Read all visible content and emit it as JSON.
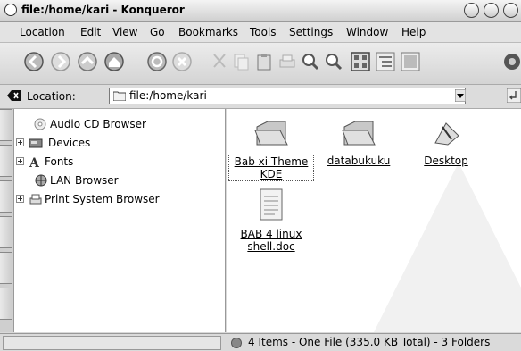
{
  "window": {
    "title": "file:/home/kari - Konqueror"
  },
  "menu": [
    "Location",
    "Edit",
    "View",
    "Go",
    "Bookmarks",
    "Tools",
    "Settings",
    "Window",
    "Help"
  ],
  "location": {
    "label": "Location:",
    "value": "file:/home/kari"
  },
  "tree": [
    {
      "label": "Audio CD Browser",
      "icon": "audio-cd-icon"
    },
    {
      "label": "Devices",
      "icon": "devices-icon"
    },
    {
      "label": "Fonts",
      "icon": "fonts-icon"
    },
    {
      "label": "LAN Browser",
      "icon": "lan-icon"
    },
    {
      "label": "Print System Browser",
      "icon": "printer-icon"
    }
  ],
  "files": [
    {
      "label": "Bab xi Theme KDE",
      "icon": "folder-icon"
    },
    {
      "label": "databukuku",
      "icon": "folder-icon"
    },
    {
      "label": "Desktop",
      "icon": "desktop-folder-icon"
    },
    {
      "label": "BAB 4 linux shell.doc",
      "icon": "document-icon"
    }
  ],
  "status": {
    "text": "4 Items - One File (335.0 KB Total) - 3 Folders"
  }
}
